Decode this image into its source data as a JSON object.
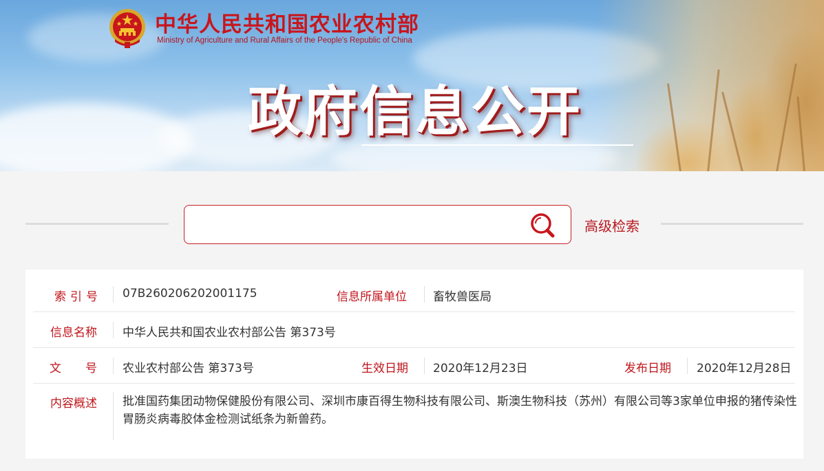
{
  "header": {
    "ministry_name_cn": "中华人民共和国农业农村部",
    "ministry_name_en": "Ministry of Agriculture and Rural Affairs of the People's Republic of China",
    "section_title": "政府信息公开"
  },
  "search": {
    "placeholder": "",
    "value": "",
    "advanced_label": "高级检索"
  },
  "info": {
    "index_no_label": "索引号",
    "index_no": "07B260206202001175",
    "unit_label": "信息所属单位",
    "unit": "畜牧兽医局",
    "name_label": "信息名称",
    "name": "中华人民共和国农业农村部公告 第373号",
    "doc_no_label": "文号",
    "doc_no": "农业农村部公告 第373号",
    "effective_label": "生效日期",
    "effective_date": "2020年12月23日",
    "publish_label": "发布日期",
    "publish_date": "2020年12月28日",
    "summary_label": "内容概述",
    "summary": "批准国药集团动物保健股份有限公司、深圳市康百得生物科技有限公司、斯澳生物科技（苏州）有限公司等3家单位申报的猪传染性胃肠炎病毒胶体金检测试纸条为新兽药。"
  },
  "colors": {
    "brand_red": "#c0161c",
    "text": "#333333",
    "sky": "#8cc0ea"
  },
  "icons": [
    "national-emblem-icon",
    "search-icon"
  ]
}
